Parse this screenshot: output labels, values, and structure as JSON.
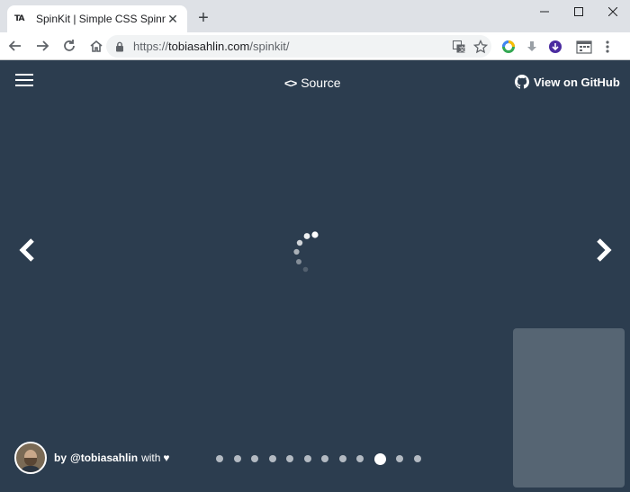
{
  "browser": {
    "tab_title": "SpinKit | Simple CSS Spinners",
    "favicon_text": "TA",
    "url_prefix": "https://",
    "url_host": "tobiasahlin.com",
    "url_path": "/spinkit/"
  },
  "header": {
    "source_label": "Source",
    "source_icon": "<>",
    "github_label": "View on GitHub"
  },
  "footer": {
    "by_label": "by",
    "handle": "@tobiasahlin",
    "with_label": "with",
    "heart": "♥"
  },
  "pager": {
    "count": 12,
    "active_index": 9
  },
  "colors": {
    "page_background": "#2c3d4f",
    "foreground": "#ffffff",
    "inactive_dot": "#b3bac2",
    "overlay_panel": "#566573"
  }
}
